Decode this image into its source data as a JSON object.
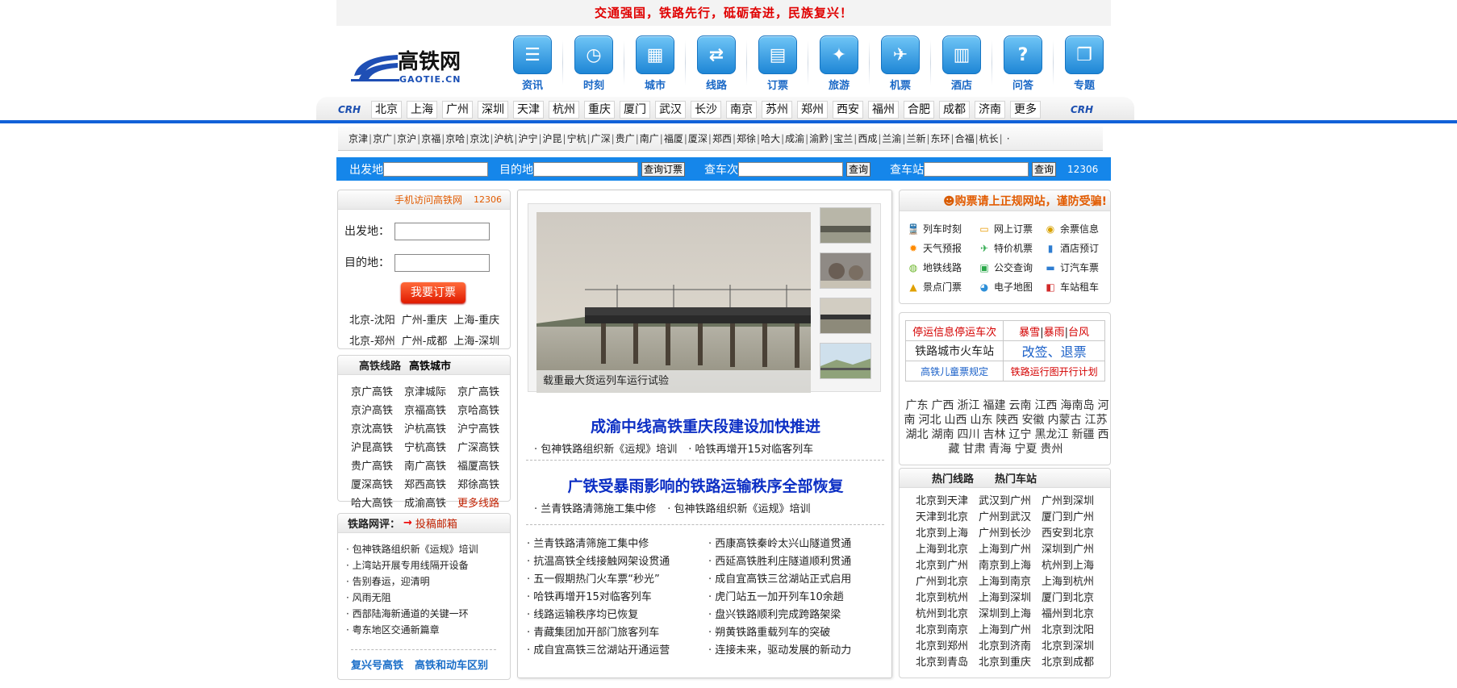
{
  "slogan": "交通强国，铁路先行，砥砺奋进，民族复兴！",
  "logo": {
    "name": "高铁网",
    "domain": "GAOTIE.CN"
  },
  "icon_nav": [
    {
      "label": "资讯",
      "icon": "list-icon"
    },
    {
      "label": "时刻",
      "icon": "clock-icon"
    },
    {
      "label": "城市",
      "icon": "building-icon"
    },
    {
      "label": "线路",
      "icon": "shuffle-icon"
    },
    {
      "label": "订票",
      "icon": "ticket-icon"
    },
    {
      "label": "旅游",
      "icon": "compass-icon"
    },
    {
      "label": "机票",
      "icon": "plane-icon"
    },
    {
      "label": "酒店",
      "icon": "hotel-icon"
    },
    {
      "label": "问答",
      "icon": "question-icon"
    },
    {
      "label": "专题",
      "icon": "book-icon"
    }
  ],
  "city_nav": {
    "crh": "CRH",
    "cities": [
      "北京",
      "上海",
      "广州",
      "深圳",
      "天津",
      "杭州",
      "重庆",
      "厦门",
      "武汉",
      "长沙",
      "南京",
      "苏州",
      "郑州",
      "西安",
      "福州",
      "合肥",
      "成都",
      "济南",
      "更多"
    ]
  },
  "routes": [
    "京津",
    "京广",
    "京沪",
    "京福",
    "京哈",
    "京沈",
    "沪杭",
    "沪宁",
    "沪昆",
    "宁杭",
    "广深",
    "贵广",
    "南广",
    "福厦",
    "厦深",
    "郑西",
    "郑徐",
    "哈大",
    "成渝",
    "渝黔",
    "宝兰",
    "西成",
    "兰渝",
    "兰新",
    "东环",
    "合福",
    "杭长"
  ],
  "routes_end": "·",
  "search": {
    "from_label": "出发地",
    "to_label": "目的地",
    "order_btn": "查询订票",
    "train_label": "查车次",
    "train_btn": "查询",
    "station_label": "查车站",
    "station_btn": "查询",
    "hotline": "12306"
  },
  "left_order": {
    "mobile_text": "手机访问高铁网",
    "mobile_num": "12306",
    "from_label": "出发地：",
    "to_label": "目的地：",
    "order_button": "我要订票",
    "quick_row1": [
      "北京-沈阳",
      "广州-重庆",
      "上海-重庆"
    ],
    "quick_row2": [
      "北京-郑州",
      "广州-成都",
      "上海-深圳"
    ]
  },
  "left_lines": {
    "tabs": [
      "高铁线路",
      "高铁城市"
    ],
    "items": [
      "京广高铁",
      "京津城际",
      "京广高铁",
      "京沪高铁",
      "京福高铁",
      "京哈高铁",
      "京沈高铁",
      "沪杭高铁",
      "沪宁高铁",
      "沪昆高铁",
      "宁杭高铁",
      "广深高铁",
      "贵广高铁",
      "南广高铁",
      "福厦高铁",
      "厦深高铁",
      "郑西高铁",
      "郑徐高铁",
      "哈大高铁",
      "成渝高铁"
    ],
    "more": "更多线路"
  },
  "left_review": {
    "title": "铁路网评：",
    "arrow": "→",
    "submit": "投稿邮箱",
    "items": [
      "包神铁路组织新《运规》培训",
      "上湾站开展专用线隔开设备",
      "告别春运，迎清明",
      "风雨无阻",
      "西部陆海新通道的关键一环",
      "粤东地区交通新篇章"
    ],
    "footer_links": [
      "复兴号高铁",
      "高铁和动车区别"
    ]
  },
  "middle": {
    "main_caption": "载重最大货运列车运行试验",
    "headline1": "成渝中线高铁重庆段建设加快推进",
    "sub1": [
      "包神铁路组织新《运规》培训",
      "哈铁再增开15对临客列车"
    ],
    "headline2": "广铁受暴雨影响的铁路运输秩序全部恢复",
    "sub2": [
      "兰青铁路清筛施工集中修",
      "包神铁路组织新《运规》培训"
    ],
    "news_left": [
      "兰青铁路清筛施工集中修",
      "抗温高铁全线接触网架设贯通",
      "五一假期热门火车票“秒光”",
      "哈铁再增开15对临客列车",
      "线路运输秩序均已恢复",
      "青藏集团加开部门旅客列车",
      "成自宜高铁三岔湖站开通运营"
    ],
    "news_right": [
      "西康高铁秦岭太兴山隧道贯通",
      "西延高铁胜利庄隧道顺利贯通",
      "成自宜高铁三岔湖站正式启用",
      "虎门站五一加开列车10余趟",
      "盘兴铁路顺利完成跨路架梁",
      "朔黄铁路重载列车的突破",
      "连接未来，驱动发展的新动力"
    ]
  },
  "right_services": {
    "warning": "购票请上正规网站，谨防受骗!",
    "items": [
      {
        "label": "列车时刻",
        "icon": "train-icon",
        "color": "#3a7bd5"
      },
      {
        "label": "网上订票",
        "icon": "seat-icon",
        "color": "#e89a00"
      },
      {
        "label": "余票信息",
        "icon": "coin-icon",
        "color": "#d8a100"
      },
      {
        "label": "天气预报",
        "icon": "sun-icon",
        "color": "#ff8a00"
      },
      {
        "label": "特价机票",
        "icon": "plane-icon",
        "color": "#2ba84a"
      },
      {
        "label": "酒店预订",
        "icon": "bars-icon",
        "color": "#2e7dd1"
      },
      {
        "label": "地铁线路",
        "icon": "subway-icon",
        "color": "#6bb52a"
      },
      {
        "label": "公交查询",
        "icon": "bus-icon",
        "color": "#2ba84a"
      },
      {
        "label": "订汽车票",
        "icon": "coach-icon",
        "color": "#2e7dd1"
      },
      {
        "label": "景点门票",
        "icon": "scenic-icon",
        "color": "#e0a000"
      },
      {
        "label": "电子地图",
        "icon": "globe-icon",
        "color": "#2e8fd8"
      },
      {
        "label": "车站租车",
        "icon": "car-icon",
        "color": "#d12a2a"
      }
    ]
  },
  "right_info": {
    "r1c1": "停运信息停运车次",
    "r1c2": [
      "暴雪",
      "暴雨",
      "台风"
    ],
    "r2c1": "铁路城市火车站",
    "r2c2": "改签、退票",
    "r3c1": "高铁儿童票规定",
    "r3c2": "铁路运行图开行计划",
    "provinces": [
      "广东",
      "广西",
      "浙江",
      "福建",
      "云南",
      "江西",
      "海南岛",
      "河南",
      "河北",
      "山西",
      "山东",
      "陕西",
      "安徽",
      "内蒙古",
      "江苏",
      "湖北",
      "湖南",
      "四川",
      "吉林",
      "辽宁",
      "黑龙江",
      "新疆",
      "西藏",
      "甘肃",
      "青海",
      "宁夏",
      "贵州"
    ]
  },
  "right_hot": {
    "tabs": [
      "热门线路",
      "热门车站"
    ],
    "items": [
      "北京到天津",
      "武汉到广州",
      "广州到深圳",
      "天津到北京",
      "广州到武汉",
      "厦门到广州",
      "北京到上海",
      "广州到长沙",
      "西安到北京",
      "上海到北京",
      "上海到广州",
      "深圳到广州",
      "北京到广州",
      "南京到上海",
      "杭州到上海",
      "广州到北京",
      "上海到南京",
      "上海到杭州",
      "北京到杭州",
      "上海到深圳",
      "厦门到北京",
      "杭州到北京",
      "深圳到上海",
      "福州到北京",
      "北京到南京",
      "上海到广州",
      "北京到沈阳",
      "北京到郑州",
      "北京到济南",
      "北京到深圳",
      "北京到青岛",
      "北京到重庆",
      "北京到成都"
    ]
  }
}
